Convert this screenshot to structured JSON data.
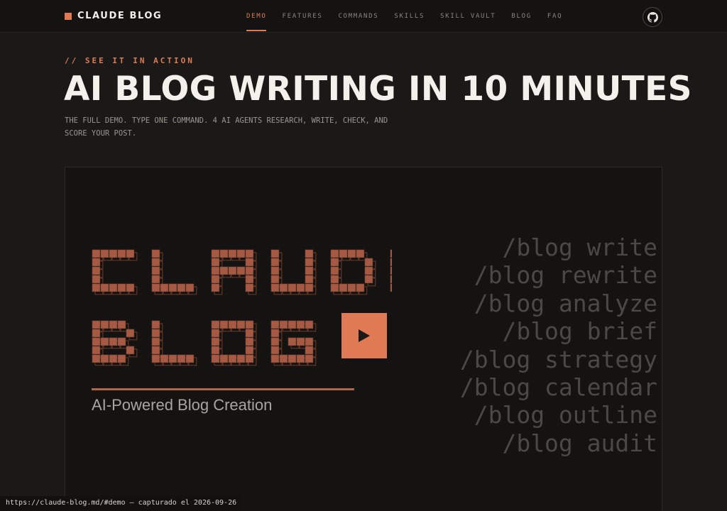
{
  "nav": {
    "brand": "CLAUDE BLOG",
    "links": [
      "DEMO",
      "FEATURES",
      "COMMANDS",
      "SKILLS",
      "SKILL VAULT",
      "BLOG",
      "FAQ"
    ],
    "active_link": "DEMO",
    "github_icon": "github-icon"
  },
  "hero": {
    "eyebrow": "// SEE IT IN ACTION",
    "title": "AI BLOG WRITING IN 10 MINUTES",
    "subtitle": "THE FULL DEMO. TYPE ONE COMMAND. 4 AI AGENTS RESEARCH, WRITE, CHECK, AND SCORE YOUR POST."
  },
  "video": {
    "logo_lines": [
      "CLAUDE",
      "BLOG"
    ],
    "tagline": "AI-Powered Blog Creation",
    "play_icon": "play-icon",
    "commands": [
      "/blog write",
      "/blog rewrite",
      "/blog analyze",
      "/blog brief",
      "/blog strategy",
      "/blog calendar",
      "/blog outline",
      "/blog audit"
    ]
  },
  "statusbar": {
    "text": "https://claude-blog.md/#demo — capturado el 2026-09-26"
  },
  "colors": {
    "accent": "#e07a55",
    "background": "#1a1918",
    "logo_brick": "#a65a43"
  }
}
